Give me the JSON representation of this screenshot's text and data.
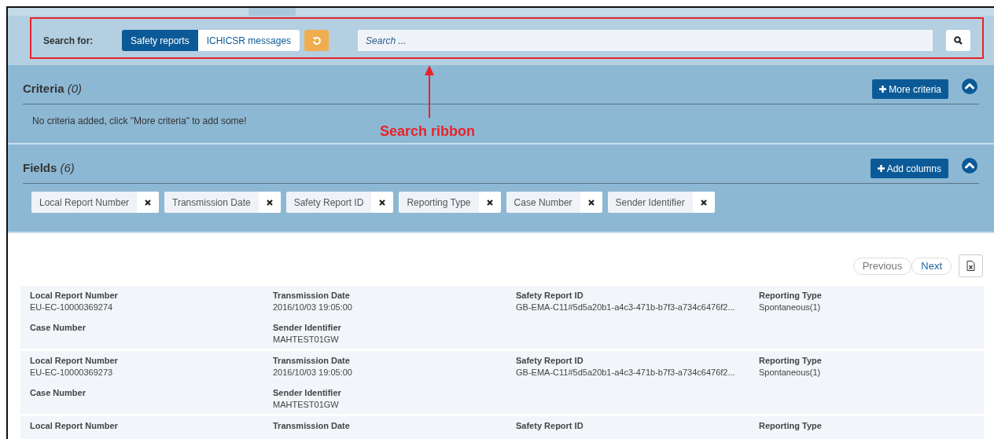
{
  "search_ribbon": {
    "label": "Search for:",
    "modes": [
      {
        "label": "Safety reports",
        "selected": true
      },
      {
        "label": "ICHICSR messages",
        "selected": false
      }
    ],
    "search": {
      "placeholder": "Search ..."
    }
  },
  "criteria": {
    "title": "Criteria",
    "count": "(0)",
    "button": "More criteria",
    "expanded": true,
    "message": "No criteria added, click \"More criteria\" to add some!"
  },
  "fields": {
    "title": "Fields",
    "count": "(6)",
    "button": "Add columns",
    "expanded": true,
    "chips": [
      "Local Report Number",
      "Transmission Date",
      "Safety Report ID",
      "Reporting Type",
      "Case Number",
      "Sender Identifier"
    ]
  },
  "pagination": {
    "previous": {
      "label": "Previous",
      "disabled": true
    },
    "next": {
      "label": "Next",
      "disabled": false
    }
  },
  "results": [
    {
      "cells": [
        {
          "label": "Local Report Number",
          "value": "EU-EC-10000369274"
        },
        {
          "label": "Transmission Date",
          "value": "2016/10/03 19:05:00"
        },
        {
          "label": "Safety Report ID",
          "value": "GB-EMA-C11#5d5a20b1-a4c3-471b-b7f3-a734c6476f2..."
        },
        {
          "label": "Reporting Type",
          "value": "Spontaneous(1)"
        },
        {
          "label": "Case Number"
        },
        {
          "label": "Sender Identifier",
          "value": "MAHTEST01GW"
        }
      ]
    },
    {
      "cells": [
        {
          "label": "Local Report Number",
          "value": "EU-EC-10000369273"
        },
        {
          "label": "Transmission Date",
          "value": "2016/10/03 19:05:00"
        },
        {
          "label": "Safety Report ID",
          "value": "GB-EMA-C11#5d5a20b1-a4c3-471b-b7f3-a734c6476f2..."
        },
        {
          "label": "Reporting Type",
          "value": "Spontaneous(1)"
        },
        {
          "label": "Case Number"
        },
        {
          "label": "Sender Identifier",
          "value": "MAHTEST01GW"
        }
      ]
    },
    {
      "cells": [
        {
          "label": "Local Report Number"
        },
        {
          "label": "Transmission Date"
        },
        {
          "label": "Safety Report ID"
        },
        {
          "label": "Reporting Type"
        }
      ]
    }
  ],
  "annotation": {
    "label": "Search ribbon"
  }
}
